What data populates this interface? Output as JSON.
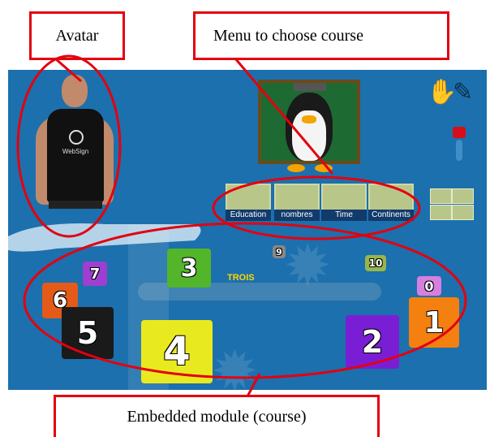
{
  "callouts": {
    "avatar": "Avatar",
    "menu": "Menu to choose course",
    "course": "Embedded module (course)"
  },
  "avatar": {
    "shirt_text": "WebSign"
  },
  "courses": [
    {
      "label": "Education"
    },
    {
      "label": "nombres"
    },
    {
      "label": "Time"
    },
    {
      "label": "Continents"
    }
  ],
  "module": {
    "word": "TROIS",
    "cubes": [
      "7",
      "6",
      "5",
      "3",
      "4",
      "9",
      "10",
      "0",
      "1",
      "2"
    ]
  },
  "colors": {
    "background": "#1c70ad",
    "callout_border": "#e3000f",
    "ellipse": "#e3000f"
  },
  "icons": [
    "hand-sign-icon",
    "pen-icon",
    "red-toggle-icon",
    "teacher-penguin-icon"
  ]
}
